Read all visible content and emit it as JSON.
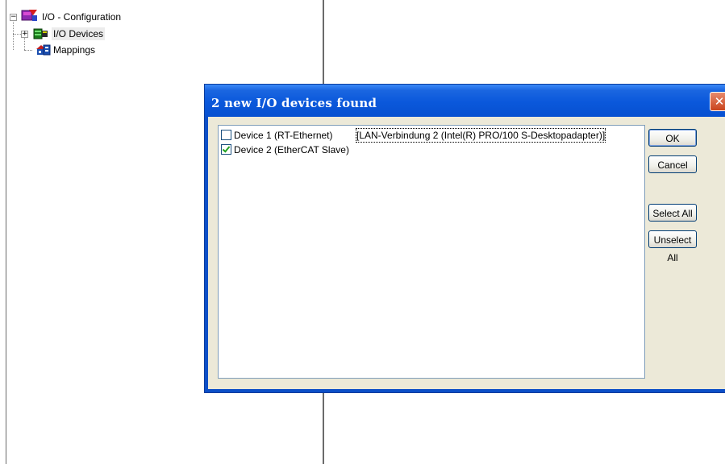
{
  "tree": {
    "root_label": "I/O - Configuration",
    "devices_label": "I/O Devices",
    "mappings_label": "Mappings",
    "expander_collapse": "−",
    "expander_expand": "+"
  },
  "dialog": {
    "title": "2 new I/O devices found",
    "close_glyph": "✕",
    "items": [
      {
        "name": "Device 1 (RT-Ethernet)",
        "adapter": "[LAN-Verbindung 2 (Intel(R) PRO/100 S-Desktopadapter)]",
        "checked": false
      },
      {
        "name": "Device 2 (EtherCAT Slave)",
        "adapter": "",
        "checked": true
      }
    ],
    "buttons": {
      "ok": "OK",
      "cancel": "Cancel",
      "select_all": "Select All",
      "unselect_all": "Unselect All"
    }
  },
  "colors": {
    "titlebar": "#0a58db",
    "dialog_face": "#ece9d8",
    "close_button": "#c9441d",
    "checkmark": "#21a121"
  }
}
